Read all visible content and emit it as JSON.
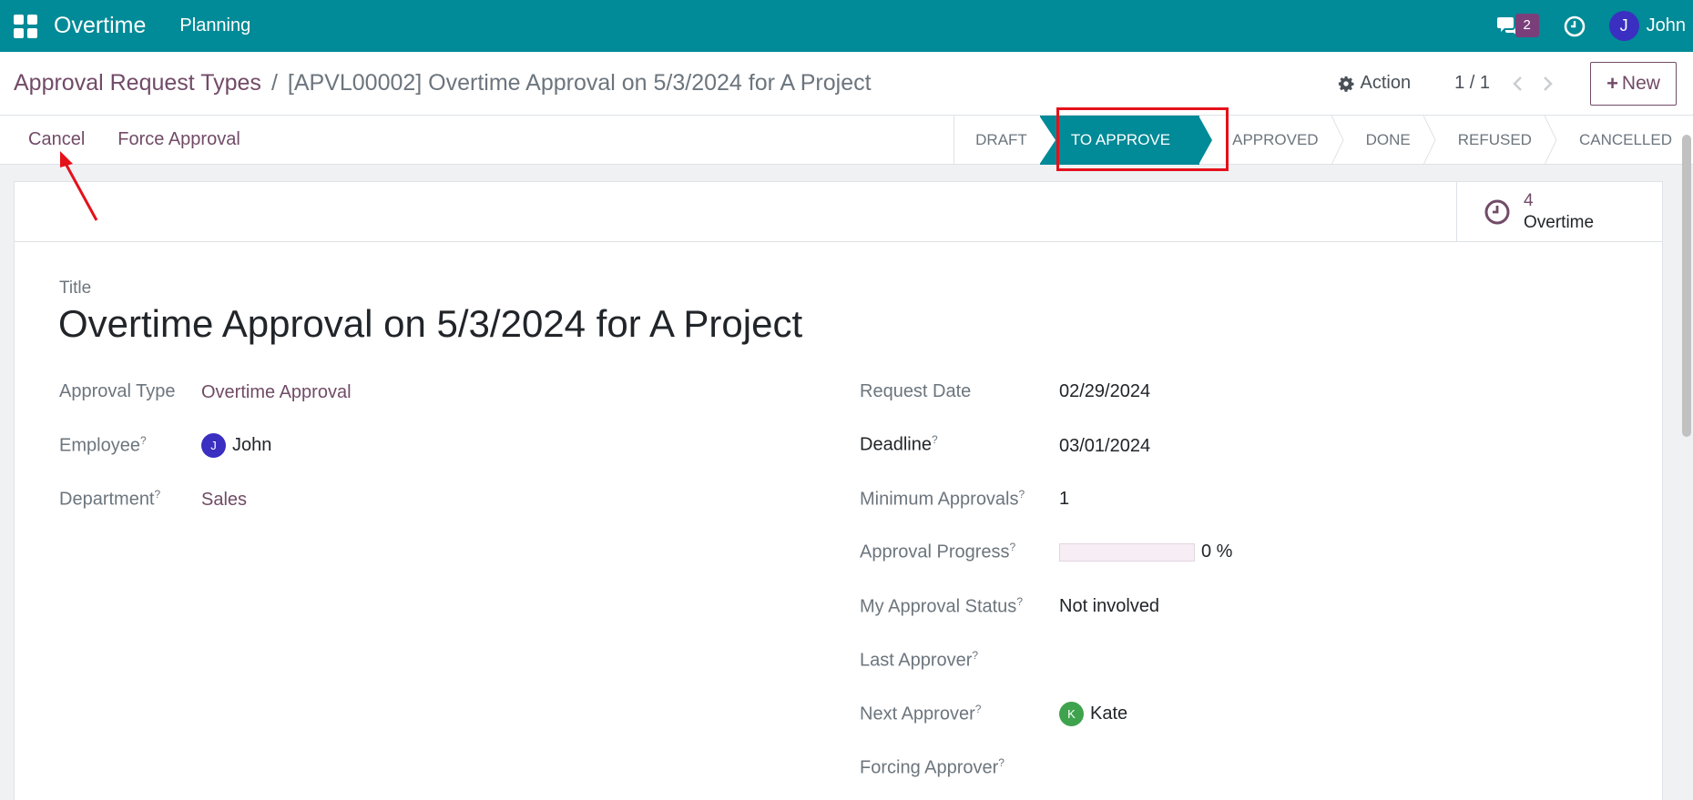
{
  "navbar": {
    "app_name": "Overtime",
    "menu_planning": "Planning",
    "message_count": "2",
    "user_initial": "J",
    "user_name": "John"
  },
  "breadcrumb": {
    "parent": "Approval Request Types",
    "separator": "/",
    "current": "[APVL00002] Overtime Approval on 5/3/2024 for A Project"
  },
  "control": {
    "action_label": "Action",
    "pager_value": "1 / 1",
    "new_label": "New",
    "new_plus": "+"
  },
  "statusbar": {
    "cancel_label": "Cancel",
    "force_label": "Force Approval",
    "stages": [
      "DRAFT",
      "TO APPROVE",
      "APPROVED",
      "DONE",
      "REFUSED",
      "CANCELLED"
    ],
    "active_stage": "TO APPROVE"
  },
  "smart_button": {
    "count": "4",
    "label": "Overtime"
  },
  "form": {
    "title_label": "Title",
    "title_value": "Overtime Approval on 5/3/2024 for A Project",
    "approval_type_label": "Approval Type",
    "approval_type_value": "Overtime Approval",
    "employee_label": "Employee",
    "employee_initial": "J",
    "employee_value": "John",
    "department_label": "Department",
    "department_value": "Sales",
    "request_date_label": "Request Date",
    "request_date_value": "02/29/2024",
    "deadline_label": "Deadline",
    "deadline_value": "03/01/2024",
    "min_approvals_label": "Minimum Approvals",
    "min_approvals_value": "1",
    "progress_label": "Approval Progress",
    "progress_value": "0 %",
    "progress_fraction": 0,
    "my_status_label": "My Approval Status",
    "my_status_value": "Not involved",
    "last_approver_label": "Last Approver",
    "next_approver_label": "Next Approver",
    "next_approver_initial": "K",
    "next_approver_value": "Kate",
    "forcing_approver_label": "Forcing Approver",
    "help_mark": "?"
  },
  "colors": {
    "brand": "#018a97",
    "link": "#714b67",
    "highlight": "#e4111b"
  }
}
